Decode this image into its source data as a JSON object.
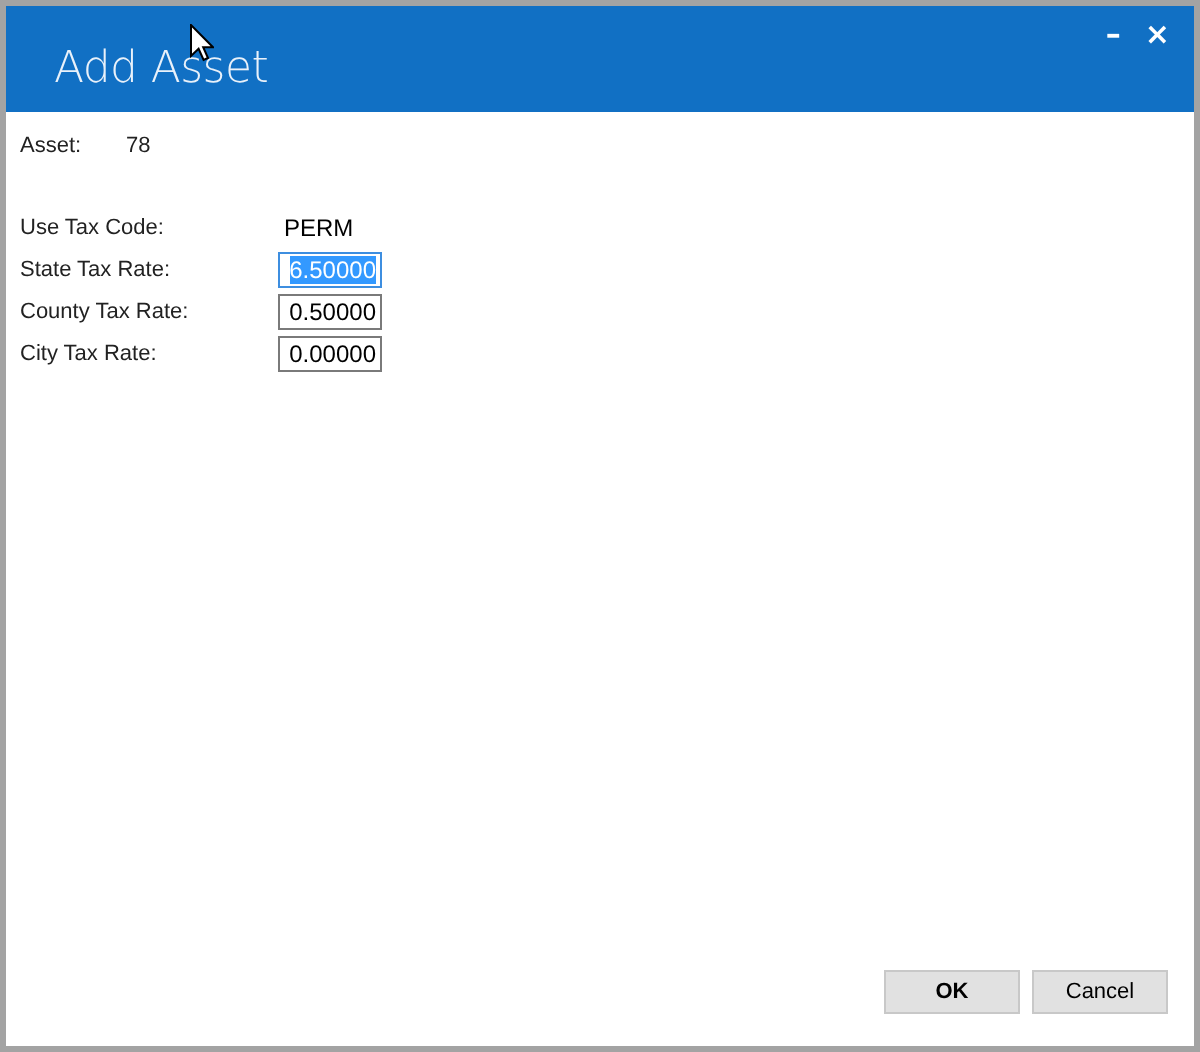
{
  "window": {
    "title": "Add Asset",
    "controls": [
      "–",
      "×"
    ]
  },
  "asset": {
    "label": "Asset:",
    "value": "78"
  },
  "tax_code": {
    "label": "Use Tax Code:",
    "value": "PERM"
  },
  "rates": [
    {
      "label": "State Tax Rate:",
      "value": "6.50000",
      "focused": true
    },
    {
      "label": "County Tax Rate:",
      "value": "0.50000",
      "focused": false
    },
    {
      "label": "City Tax Rate:",
      "value": "0.00000",
      "focused": false
    }
  ],
  "buttons": [
    "OK",
    "Cancel"
  ]
}
